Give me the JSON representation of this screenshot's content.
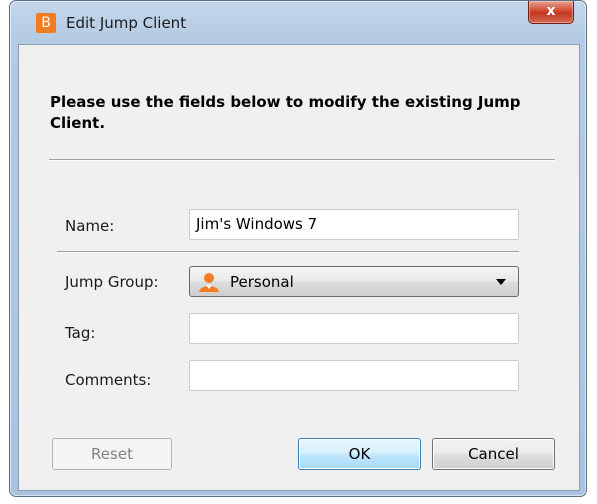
{
  "window": {
    "title": "Edit Jump Client",
    "app_icon_letter": "B",
    "close_label": "x",
    "accent_color": "#f47b20"
  },
  "instruction": "Please use the fields below to modify the existing Jump Client.",
  "form": {
    "name_label": "Name:",
    "name_value": "Jim's Windows 7",
    "jump_group_label": "Jump Group:",
    "jump_group_value": "Personal",
    "jump_group_icon": "person-icon",
    "tag_label": "Tag:",
    "tag_value": "",
    "comments_label": "Comments:",
    "comments_value": ""
  },
  "buttons": {
    "reset": "Reset",
    "ok": "OK",
    "cancel": "Cancel"
  }
}
